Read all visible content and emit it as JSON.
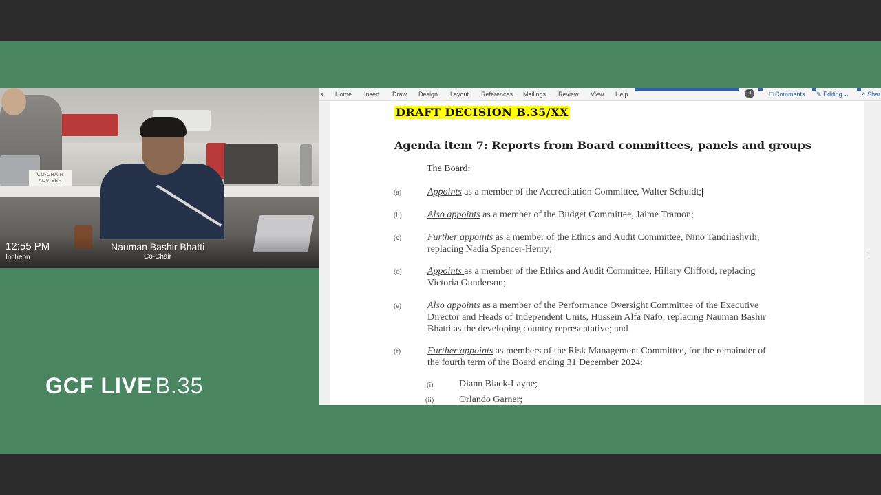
{
  "video": {
    "time": "12:55 PM",
    "city": "Incheon",
    "speaker_name": "Nauman Bashir Bhatti",
    "speaker_role": "Co-Chair",
    "sign_text": "CO-CHAIR\nADVISER"
  },
  "branding": {
    "name": "GCF LIVE",
    "session": "B.35"
  },
  "ribbon": {
    "tabs": [
      "Home",
      "Insert",
      "Draw",
      "Design",
      "Layout",
      "References",
      "Mailings",
      "Review",
      "View",
      "Help"
    ],
    "avatar": "CL",
    "comments": "Comments",
    "editing": "Editing",
    "share": "Shar"
  },
  "document": {
    "heading": "DRAFT DECISION B.35/XX",
    "agenda": "Agenda item 7:  Reports from Board committees, panels and groups",
    "board": "The Board:",
    "items": [
      {
        "label": "(a)",
        "verb": "Appoints",
        "rest": " as a member of the Accreditation Committee, Walter Schuldt;",
        "rest2": ""
      },
      {
        "label": "(b)",
        "verb": "Also appoints",
        "rest": " as a member of the Budget Committee, Jaime Tramon;",
        "rest2": ""
      },
      {
        "label": "(c)",
        "verb": "Further appoints",
        "rest": " as a member of the Ethics and Audit Committee, Nino Tandilashvili,",
        "rest2": "replacing Nadia Spencer-Henry;"
      },
      {
        "label": "(d)",
        "verb": "Appoints ",
        "rest": "as a member of the Ethics and Audit Committee, Hillary Clifford, replacing",
        "rest2": "Victoria Gunderson;"
      },
      {
        "label": "(e)",
        "verb": "Also appoints",
        "rest": " as a member of the Performance Oversight Committee of the Executive",
        "rest2": "Director and Heads of Independent Units, Hussein Alfa Nafo, replacing Nauman Bashir",
        "rest3": "Bhatti as the developing country representative; and"
      },
      {
        "label": "(f)",
        "verb": "Further appoints",
        "rest": " as members of the Risk Management Committee, for the remainder of",
        "rest2": "the fourth term of the Board ending 31 December 2024:"
      }
    ],
    "subitems": [
      {
        "label": "(i)",
        "text": "Diann Black-Layne;"
      },
      {
        "label": "(ii)",
        "text": "Orlando Garner;"
      }
    ]
  }
}
